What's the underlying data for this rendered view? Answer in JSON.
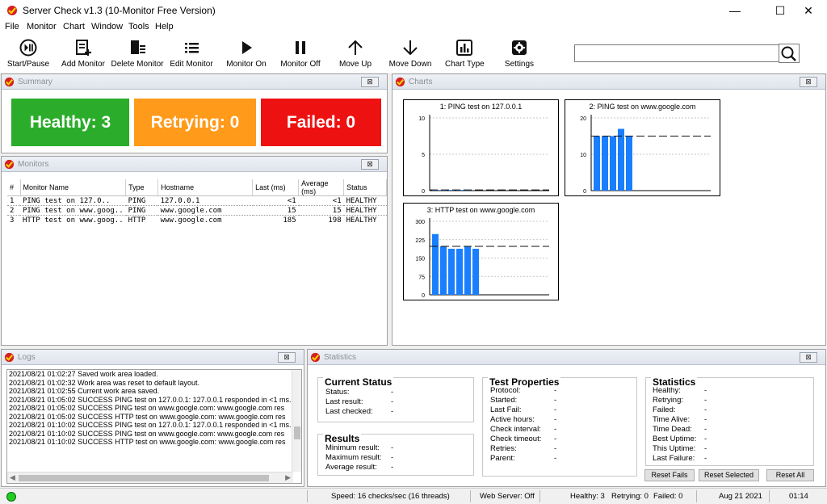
{
  "window": {
    "title": "Server Check v1.3 (10-Monitor Free Version)",
    "minimize": "—",
    "maximize": "☐",
    "close": "✕"
  },
  "menu": [
    "File",
    "Monitor",
    "Chart",
    "Window",
    "Tools",
    "Help"
  ],
  "toolbar": [
    {
      "label": "Start/Pause",
      "icon": "start-pause-icon"
    },
    {
      "label": "Add Monitor",
      "icon": "add-monitor-icon"
    },
    {
      "label": "Delete Monitor",
      "icon": "delete-monitor-icon"
    },
    {
      "label": "Edit Monitor",
      "icon": "edit-monitor-icon"
    },
    {
      "label": "Monitor On",
      "icon": "play-icon"
    },
    {
      "label": "Monitor Off",
      "icon": "pause-icon"
    },
    {
      "label": "Move Up",
      "icon": "arrow-up-icon"
    },
    {
      "label": "Move Down",
      "icon": "arrow-down-icon"
    },
    {
      "label": "Chart Type",
      "icon": "chart-icon"
    },
    {
      "label": "Settings",
      "icon": "gear-icon"
    }
  ],
  "search": {
    "value": ""
  },
  "summary": {
    "title": "Summary",
    "healthy": "Healthy: 3",
    "retrying": "Retrying: 0",
    "failed": "Failed: 0",
    "colors": {
      "healthy": "#2bad2b",
      "retrying": "#ff9a1a",
      "failed": "#ee1111"
    }
  },
  "monitors": {
    "title": "Monitors",
    "headers": [
      "#",
      "Monitor Name",
      "Type",
      "Hostname",
      "Last (ms)",
      "Average (ms)",
      "Status"
    ],
    "rows": [
      [
        "1",
        "PING test on 127.0..",
        "PING",
        "127.0.0.1",
        "<1",
        "<1",
        "HEALTHY"
      ],
      [
        "2",
        "PING test on www.goog..",
        "PING",
        "www.google.com",
        "15",
        "15",
        "HEALTHY"
      ],
      [
        "3",
        "HTTP test on www.goog..",
        "HTTP",
        "www.google.com",
        "185",
        "198",
        "HEALTHY"
      ]
    ]
  },
  "charts_panel": {
    "title": "Charts"
  },
  "chart_data": [
    {
      "type": "bar",
      "title": "1: PING test on 127.0.0.1",
      "ylim": [
        0,
        10
      ],
      "yticks": [
        0,
        5,
        10
      ],
      "values": [
        0.1,
        0.1,
        0.1,
        0.1,
        0.1
      ],
      "average": 0.1,
      "bar_color": "#1a7fff"
    },
    {
      "type": "bar",
      "title": "2: PING test on www.google.com",
      "ylim": [
        0,
        20
      ],
      "yticks": [
        0,
        10,
        20
      ],
      "values": [
        15,
        15,
        15,
        17,
        15
      ],
      "average": 15,
      "bar_color": "#1a7fff"
    },
    {
      "type": "bar",
      "title": "3: HTTP test on www.google.com",
      "ylim": [
        0,
        300
      ],
      "yticks": [
        0,
        75,
        150,
        225,
        300
      ],
      "values": [
        248,
        198,
        188,
        188,
        198,
        188
      ],
      "average": 198,
      "bar_color": "#1a7fff"
    }
  ],
  "logs": {
    "title": "Logs",
    "lines": [
      "2021/08/21  01:02:27  Saved work area loaded.",
      "2021/08/21  01:02:32  Work area was reset to default layout.",
      "2021/08/21  01:02:55  Current work area saved.",
      "2021/08/21  01:05:02  SUCCESS  PING test on 127.0.0.1: 127.0.0.1 responded in <1 ms.",
      "2021/08/21  01:05:02  SUCCESS  PING test on www.google.com: www.google.com res",
      "2021/08/21  01:05:02  SUCCESS  HTTP test on www.google.com: www.google.com res",
      "2021/08/21  01:10:02  SUCCESS  PING test on 127.0.0.1: 127.0.0.1 responded in <1 ms.",
      "2021/08/21  01:10:02  SUCCESS  PING test on www.google.com: www.google.com res",
      "2021/08/21  01:10:02  SUCCESS  HTTP test on www.google.com: www.google.com res"
    ]
  },
  "statistics": {
    "title": "Statistics",
    "current_status": {
      "heading": "Current Status",
      "rows": [
        [
          "Status:",
          "-"
        ],
        [
          "Last result:",
          "-"
        ],
        [
          "Last checked:",
          "-"
        ]
      ]
    },
    "results": {
      "heading": "Results",
      "rows": [
        [
          "Minimum result:",
          "-"
        ],
        [
          "Maximum result:",
          "-"
        ],
        [
          "Average result:",
          "-"
        ]
      ]
    },
    "test_properties": {
      "heading": "Test Properties",
      "rows": [
        [
          "Protocol:",
          "-"
        ],
        [
          "Started:",
          "-"
        ],
        [
          "Last Fail:",
          "-"
        ],
        [
          "Active hours:",
          "-"
        ],
        [
          "Check interval:",
          "-"
        ],
        [
          "Check timeout:",
          "-"
        ],
        [
          "Retries:",
          "-"
        ],
        [
          "Parent:",
          "-"
        ]
      ]
    },
    "stats": {
      "heading": "Statistics",
      "rows": [
        [
          "Healthy:",
          "-"
        ],
        [
          "Retrying:",
          "-"
        ],
        [
          "Failed:",
          "-"
        ],
        [
          "Time Alive:",
          "-"
        ],
        [
          "Time Dead:",
          "-"
        ],
        [
          "Best Uptime:",
          "-"
        ],
        [
          "This Uptime:",
          "-"
        ],
        [
          "Last Failure:",
          "-"
        ]
      ]
    },
    "buttons": {
      "reset_fails": "Reset Fails",
      "reset_selected": "Reset Selected",
      "reset_all": "Reset All"
    }
  },
  "statusbar": {
    "speed": "Speed: 16 checks/sec (16 threads)",
    "web_server": "Web Server: Off",
    "healthy": "Healthy: 3",
    "retrying": "Retrying: 0",
    "failed": "Failed: 0",
    "date": "Aug 21 2021",
    "time": "01:14",
    "indicator_color": "#22cc22"
  }
}
